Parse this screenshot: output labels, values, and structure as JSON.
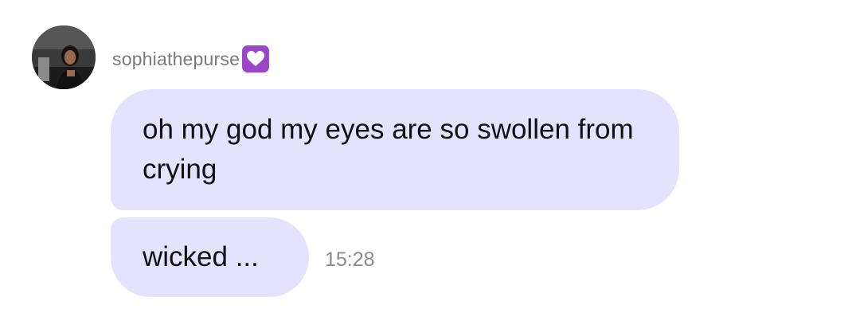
{
  "sender": {
    "username": "sophiathepurse",
    "badge_icon": "purple-heart-icon",
    "badge_color": "#9a46c8"
  },
  "messages": [
    {
      "text": "oh my god my eyes are so swollen from crying"
    },
    {
      "text": "wicked ...",
      "timestamp": "15:28"
    }
  ],
  "colors": {
    "bubble_background": "#e4e2fd",
    "background": "#ffffff"
  }
}
